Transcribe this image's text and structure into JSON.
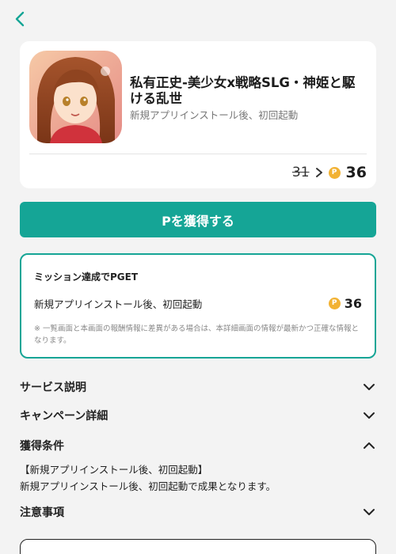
{
  "app": {
    "title": "私有正史-美少女x戦略SLG・神姫と駆ける乱世",
    "subtitle": "新規アプリインストール後、初回起動",
    "old_price": "31",
    "new_price": "36",
    "coin_symbol": "P"
  },
  "cta": {
    "label": "Pを獲得する"
  },
  "mission": {
    "title": "ミッション達成でPGET",
    "row_label": "新規アプリインストール後、初回起動",
    "points": "36",
    "note": "※ 一覧画面と本画面の報酬情報に差異がある場合は、本詳細画面の情報が最新かつ正確な情報となります。"
  },
  "sections": {
    "service": "サービス説明",
    "campaign": "キャンペーン詳細",
    "conditions": "獲得条件",
    "notes": "注意事項"
  },
  "conditions": {
    "heading": "【新規アプリインストール後、初回起動】",
    "body": "新規アプリインストール後、初回起動で成果となります。"
  },
  "colors": {
    "accent": "#15a596",
    "coin": "#f2b233",
    "background": "#f3f3f3"
  },
  "icons": {
    "back": "chevron-left-icon",
    "expand": "chevron-down-icon",
    "collapse": "chevron-up-icon",
    "coin": "point-coin-icon"
  }
}
